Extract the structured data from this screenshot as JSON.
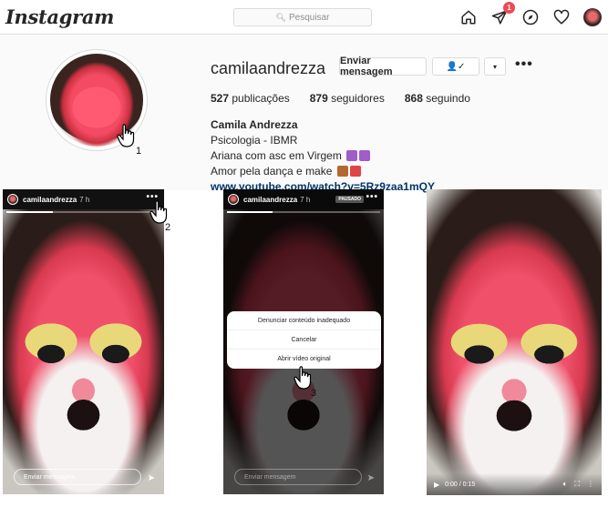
{
  "header": {
    "logo": "Instagram",
    "search_placeholder": "Pesquisar",
    "notification_count": "1",
    "icons": [
      "home-icon",
      "direct-icon",
      "explore-icon",
      "activity-icon",
      "avatar"
    ]
  },
  "profile": {
    "username": "camilaandrezza",
    "message_button": "Enviar mensagem",
    "following_button": "👤✓",
    "caret": "▾",
    "more": "•••",
    "stats": {
      "posts_count": "527",
      "posts_label": "publicações",
      "followers_count": "879",
      "followers_label": "seguidores",
      "following_count": "868",
      "following_label": "seguindo"
    },
    "bio": {
      "full_name": "Camila Andrezza",
      "line1": "Psicologia - IBMR",
      "line2": "Ariana com asc em Virgem",
      "line3": "Amor pela dança e make",
      "link": "www.youtube.com/watch?v=5Rz9zaa1mQY"
    }
  },
  "annotations": {
    "step1": "1",
    "step2": "2",
    "step3": "3"
  },
  "stories": {
    "username": "camilaandrezza",
    "time": "7 h",
    "dots": "•••",
    "paused_label": "PAUSADO",
    "reply_placeholder": "Enviar mensagem",
    "menu": {
      "report": "Denunciar conteúdo inadequado",
      "cancel": "Cancelar",
      "open_original": "Abrir vídeo original"
    },
    "video_time": "0:00 / 0:15"
  },
  "colors": {
    "link": "#003569",
    "badge": "#ed4956",
    "border": "#dbdbdb"
  }
}
